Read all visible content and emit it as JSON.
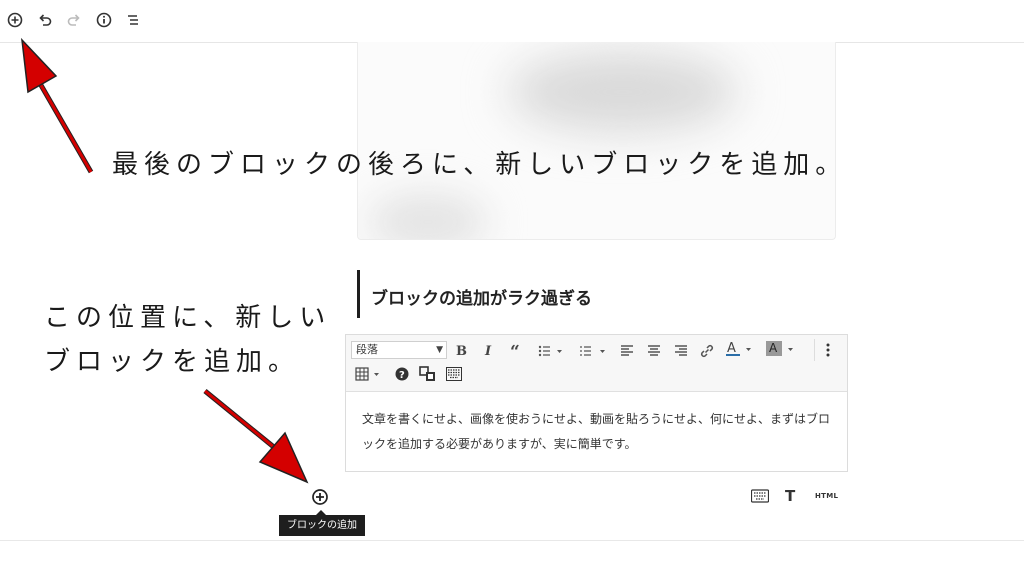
{
  "annotations": {
    "top": "最後のブロックの後ろに、新しいブロックを追加。",
    "left_line1": "この位置に、新しい",
    "left_line2": "ブロックを追加。"
  },
  "topbar": {
    "icons": [
      "add-block-icon",
      "undo-icon",
      "redo-icon",
      "info-icon",
      "outline-icon"
    ]
  },
  "heading": {
    "text": "ブロックの追加がラク過ぎる"
  },
  "classic_toolbar": {
    "format_select": "段落",
    "buttons": [
      "B",
      "I",
      "“",
      "list-bullet",
      "list-numbered",
      "align-left",
      "align-center",
      "align-right",
      "link",
      "A",
      "A",
      "more",
      "table",
      "?",
      "special-char",
      "keyboard"
    ]
  },
  "classic_content": {
    "text": "文章を書くにせよ、画像を使おうにせよ、動画を貼ろうにせよ、何にせよ、まずはブロックを追加する必要がありますが、実に簡単です。"
  },
  "inserter": {
    "tooltip": "ブロックの追加"
  },
  "block_mode_icons": [
    "keyboard-icon",
    "text-icon",
    "html-icon"
  ],
  "block_mode_labels": {
    "text": "T",
    "html": "HTML"
  },
  "colors": {
    "arrow": "#d40000",
    "dark": "#1e1e1e",
    "toolbar_bg": "#f7f7f7"
  }
}
